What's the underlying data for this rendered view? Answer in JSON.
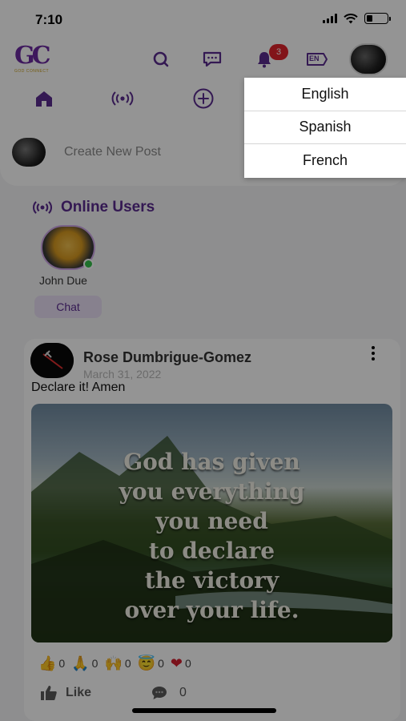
{
  "status_bar": {
    "time": "7:10",
    "icons": [
      "cellular-signal-icon",
      "wifi-icon",
      "battery-icon"
    ]
  },
  "app_bar": {
    "logo_text": "GC",
    "logo_subtext": "GOD CONNECT",
    "icons": [
      "search-icon",
      "messages-icon",
      "bell-icon",
      "language-icon"
    ],
    "notification_count": "3",
    "language_badge": "EN"
  },
  "nav": {
    "items": [
      "home-icon",
      "live-broadcast-icon",
      "add-circle-icon"
    ]
  },
  "create_post": {
    "placeholder": "Create New Post"
  },
  "online_users": {
    "title": "Online Users",
    "users": [
      {
        "name": "John Due",
        "status": "online",
        "action_label": "Chat"
      }
    ]
  },
  "post": {
    "author": "Rose Dumbrigue-Gomez",
    "date": "March 31, 2022",
    "text": "Declare it! Amen",
    "image_quote_lines": [
      "God has given",
      "you everything",
      "you need",
      "to declare",
      "the victory",
      "over your life."
    ],
    "reactions": [
      {
        "icon": "thumbs-up-icon",
        "emoji": "👍",
        "count": "0"
      },
      {
        "icon": "praying-hands-icon",
        "emoji": "🙏",
        "count": "0"
      },
      {
        "icon": "raised-hands-icon",
        "emoji": "🙌",
        "count": "0"
      },
      {
        "icon": "halo-face-icon",
        "emoji": "😇",
        "count": "0"
      },
      {
        "icon": "heart-icon",
        "emoji": "❤",
        "count": "0"
      }
    ],
    "like_label": "Like",
    "comment_count": "0"
  },
  "language_menu": {
    "options": [
      "English",
      "Spanish",
      "French"
    ]
  },
  "colors": {
    "brand_purple": "#5b2c8f",
    "badge_red": "#e0232b",
    "online_green": "#35c24a"
  }
}
